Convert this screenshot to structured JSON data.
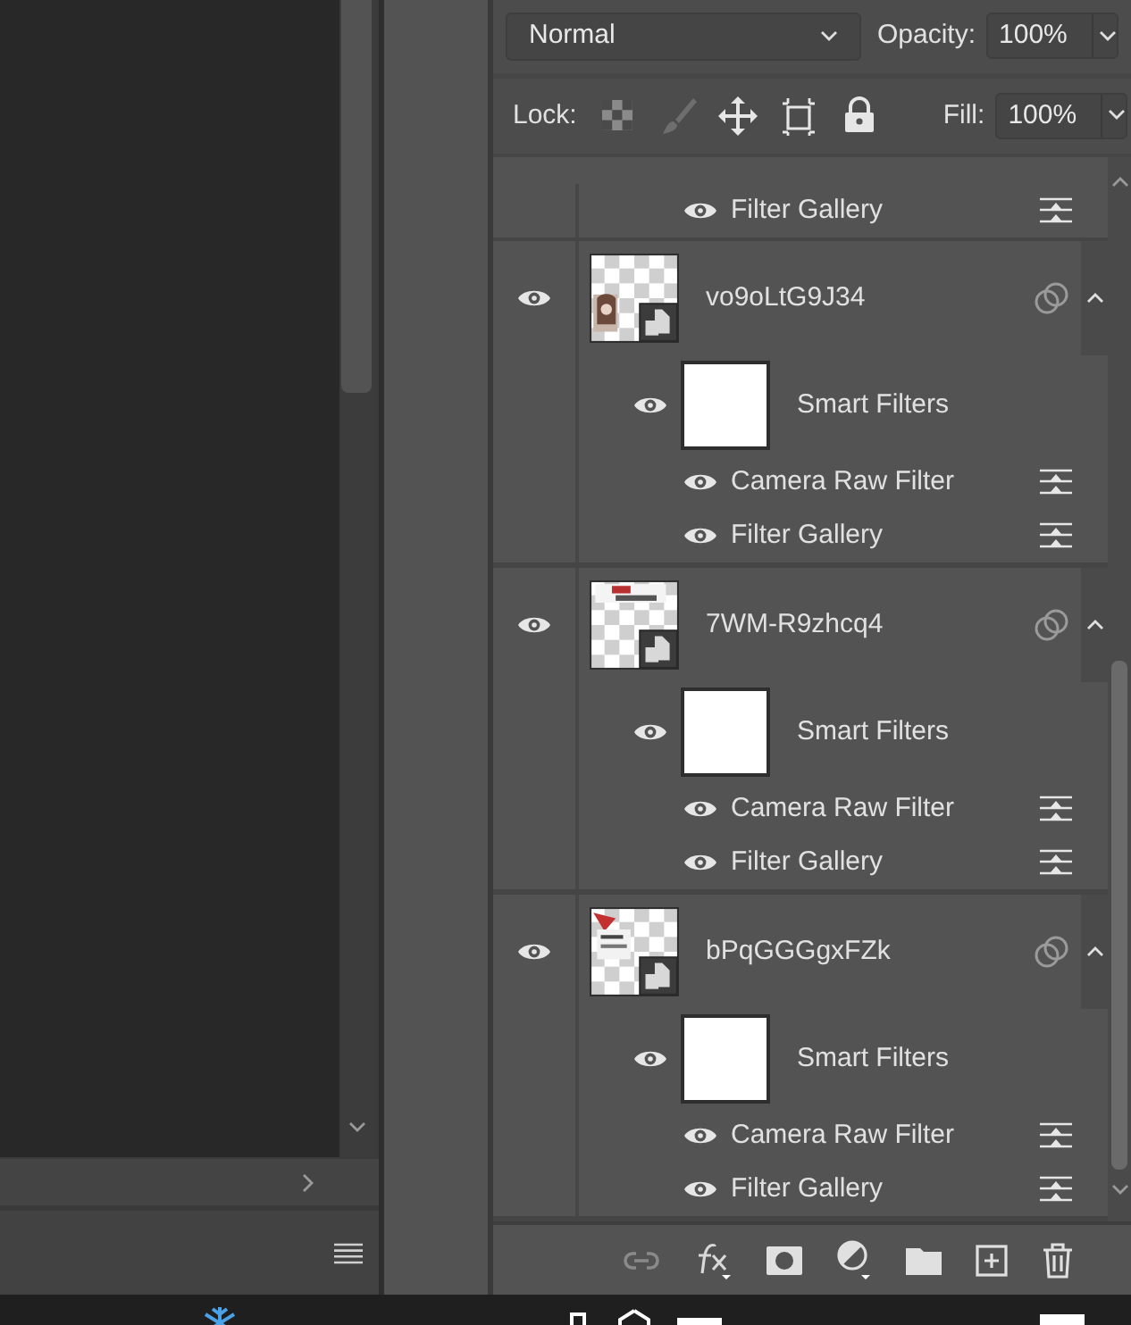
{
  "properties_bar": {
    "blend_mode": "Normal",
    "opacity_label": "Opacity:",
    "opacity": "100%",
    "lock_label": "Lock:",
    "fill_label": "Fill:",
    "fill": "100%"
  },
  "partial_filters": [
    {
      "name": "Filter Gallery",
      "visible": true
    }
  ],
  "layers": [
    {
      "name": "vo9oLtG9J34",
      "visible": true,
      "smart_filters": {
        "label": "Smart Filters",
        "visible": true
      },
      "filters": [
        {
          "name": "Camera Raw Filter",
          "visible": true
        },
        {
          "name": "Filter Gallery",
          "visible": true
        }
      ]
    },
    {
      "name": "7WM-R9zhcq4",
      "visible": true,
      "smart_filters": {
        "label": "Smart Filters",
        "visible": true
      },
      "filters": [
        {
          "name": "Camera Raw Filter",
          "visible": true
        },
        {
          "name": "Filter Gallery",
          "visible": true
        }
      ]
    },
    {
      "name": "bPqGGGgxFZk",
      "visible": true,
      "smart_filters": {
        "label": "Smart Filters",
        "visible": true
      },
      "filters": [
        {
          "name": "Camera Raw Filter",
          "visible": true
        },
        {
          "name": "Filter Gallery",
          "visible": true
        }
      ]
    }
  ]
}
